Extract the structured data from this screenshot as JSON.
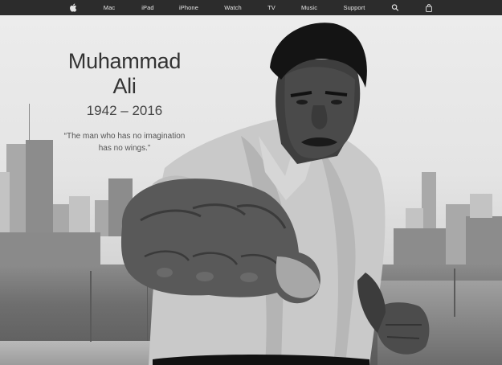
{
  "nav": {
    "logo": "apple-logo-icon",
    "items": [
      {
        "label": "Mac"
      },
      {
        "label": "iPad"
      },
      {
        "label": "iPhone"
      },
      {
        "label": "Watch"
      },
      {
        "label": "TV"
      },
      {
        "label": "Music"
      },
      {
        "label": "Support"
      }
    ],
    "search_icon": "search-icon",
    "bag_icon": "shopping-bag-icon"
  },
  "hero": {
    "title": "Muhammad Ali",
    "years": "1942 – 2016",
    "quote_line1": "“The man who has no imagination",
    "quote_line2": "has no wings.”"
  },
  "colors": {
    "nav_background": "#2c2c2c",
    "nav_text": "#e6e6e6",
    "title_text": "#333333"
  }
}
